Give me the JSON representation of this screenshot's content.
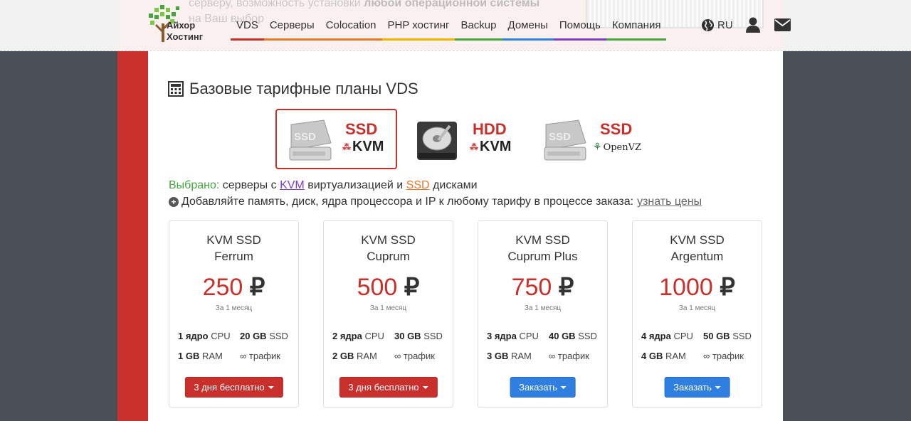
{
  "header": {
    "hidden_text_1": "серверу, возможность установки",
    "hidden_text_bold": "любой операционной системы",
    "hidden_text_2": "на Ваш выбор",
    "logo_line1": "Айхор",
    "logo_line2": "Хостинг",
    "nav": [
      {
        "label": "VDS",
        "color": "#c9302c"
      },
      {
        "label": "Серверы",
        "color": "#e8782a"
      },
      {
        "label": "Colocation",
        "color": "#e8782a"
      },
      {
        "label": "PHP хостинг",
        "color": "#f0b400"
      },
      {
        "label": "Backup",
        "color": "#43a53c"
      },
      {
        "label": "Домены",
        "color": "#2f7fe0"
      },
      {
        "label": "Помощь",
        "color": "#7b3fc4"
      },
      {
        "label": "Компания",
        "color": "#43a53c"
      }
    ],
    "lang": "RU"
  },
  "section": {
    "title": "Базовые тарифные планы VDS"
  },
  "types": [
    {
      "label": "SSD",
      "sub": "KVM",
      "active": true
    },
    {
      "label": "HDD",
      "sub": "KVM",
      "active": false
    },
    {
      "label": "SSD",
      "sub": "OpenVZ",
      "active": false
    }
  ],
  "info": {
    "selected_label": "Выбрано:",
    "selected_text_1": "серверы с",
    "kvm": "KVM",
    "selected_text_2": "виртуализацией и",
    "ssd": "SSD",
    "selected_text_3": "дисками",
    "add_text": "Добавляйте память, диск, ядра процессора и IP к любому тарифу в процессе заказа:",
    "prices_link": "узнать цены"
  },
  "plans": [
    {
      "line1": "KVM SSD",
      "line2": "Ferrum",
      "price": "250",
      "currency": "₽",
      "period": "За 1 месяц",
      "cpu_v": "1 ядро",
      "cpu_l": "CPU",
      "disk_v": "20 GB",
      "disk_l": "SSD",
      "ram_v": "1 GB",
      "ram_l": "RAM",
      "traffic": "∞ трафик",
      "button": "3 дня бесплатно"
    },
    {
      "line1": "KVM SSD",
      "line2": "Cuprum",
      "price": "500",
      "currency": "₽",
      "period": "За 1 месяц",
      "cpu_v": "2 ядра",
      "cpu_l": "CPU",
      "disk_v": "30 GB",
      "disk_l": "SSD",
      "ram_v": "2 GB",
      "ram_l": "RAM",
      "traffic": "∞ трафик",
      "button": "3 дня бесплатно"
    },
    {
      "line1": "KVM SSD",
      "line2": "Cuprum Plus",
      "price": "750",
      "currency": "₽",
      "period": "За 1 месяц",
      "cpu_v": "3 ядра",
      "cpu_l": "CPU",
      "disk_v": "40 GB",
      "disk_l": "SSD",
      "ram_v": "3 GB",
      "ram_l": "RAM",
      "traffic": "∞ трафик",
      "button": "Заказать"
    },
    {
      "line1": "KVM SSD",
      "line2": "Argentum",
      "price": "1000",
      "currency": "₽",
      "period": "За 1 месяц",
      "cpu_v": "4 ядра",
      "cpu_l": "CPU",
      "disk_v": "50 GB",
      "disk_l": "SSD",
      "ram_v": "4 GB",
      "ram_l": "RAM",
      "traffic": "∞ трафик",
      "button": "Заказать"
    }
  ],
  "icons": {
    "lang": "globe-icon",
    "user": "user-icon",
    "mail": "envelope-icon",
    "title": "calculator-icon",
    "add": "plus-circle-icon"
  }
}
